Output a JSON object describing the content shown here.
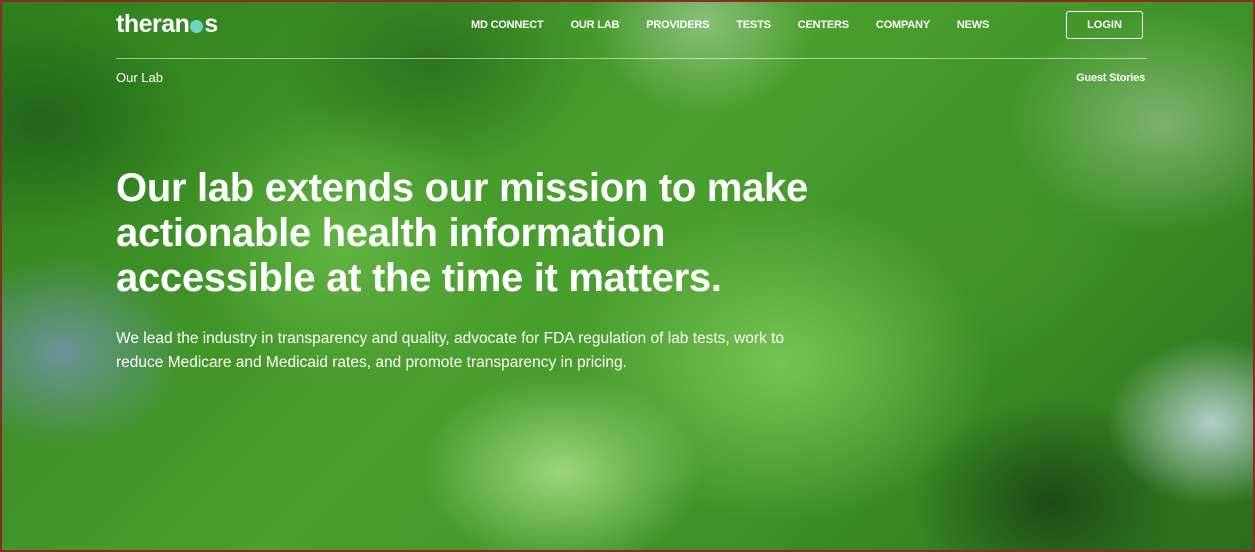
{
  "header": {
    "logo_prefix": "theran",
    "logo_suffix": "s",
    "nav_items": [
      "MD CONNECT",
      "OUR LAB",
      "PROVIDERS",
      "TESTS",
      "CENTERS",
      "COMPANY",
      "NEWS"
    ],
    "login_label": "LOGIN"
  },
  "subnav": {
    "title": "Our Lab",
    "link_label": "Guest Stories"
  },
  "hero": {
    "heading": "Our lab extends our mission to make actionable health information accessible at the time it matters.",
    "body": "We lead the industry in transparency and quality, advocate for FDA regulation of lab tests, work to reduce Medicare and Medicaid rates, and promote transparency in pricing."
  },
  "colors": {
    "background": "#3b8f22",
    "logo_dot": "#6fd3c4",
    "text": "#ffffff",
    "border": "#8b2a2a"
  }
}
